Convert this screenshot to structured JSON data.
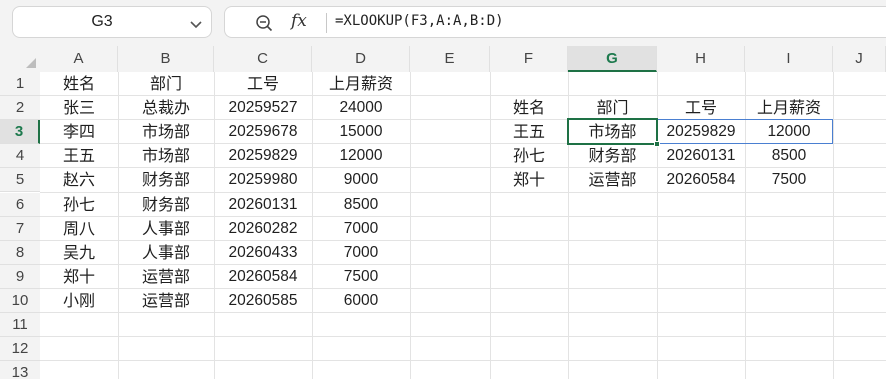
{
  "name_box": {
    "value": "G3"
  },
  "formula_bar": {
    "fx_label": "fx",
    "formula": "=XLOOKUP(F3,A:A,B:D)"
  },
  "icons": [
    "chevron-down-icon",
    "zoom-icon",
    "fx-icon"
  ],
  "accent_color": "#1e7145",
  "selected_cell": "G3",
  "columns": [
    "A",
    "B",
    "C",
    "D",
    "E",
    "F",
    "G",
    "H",
    "I",
    "J"
  ],
  "rows": [
    "1",
    "2",
    "3",
    "4",
    "5",
    "6",
    "7",
    "8",
    "9",
    "10",
    "11",
    "12",
    "13"
  ],
  "cells": {
    "A1": "姓名",
    "B1": "部门",
    "C1": "工号",
    "D1": "上月薪资",
    "A2": "张三",
    "B2": "总裁办",
    "C2": "20259527",
    "D2": "24000",
    "A3": "李四",
    "B3": "市场部",
    "C3": "20259678",
    "D3": "15000",
    "A4": "王五",
    "B4": "市场部",
    "C4": "20259829",
    "D4": "12000",
    "A5": "赵六",
    "B5": "财务部",
    "C5": "20259980",
    "D5": "9000",
    "A6": "孙七",
    "B6": "财务部",
    "C6": "20260131",
    "D6": "8500",
    "A7": "周八",
    "B7": "人事部",
    "C7": "20260282",
    "D7": "7000",
    "A8": "吴九",
    "B8": "人事部",
    "C8": "20260433",
    "D8": "7000",
    "A9": "郑十",
    "B9": "运营部",
    "C9": "20260584",
    "D9": "7500",
    "A10": "小刚",
    "B10": "运营部",
    "C10": "20260585",
    "D10": "6000",
    "F2": "姓名",
    "G2": "部门",
    "H2": "工号",
    "I2": "上月薪资",
    "F3": "王五",
    "G3": "市场部",
    "H3": "20259829",
    "I3": "12000",
    "F4": "孙七",
    "G4": "财务部",
    "H4": "20260131",
    "I4": "8500",
    "F5": "郑十",
    "G5": "运营部",
    "H5": "20260584",
    "I5": "7500"
  }
}
